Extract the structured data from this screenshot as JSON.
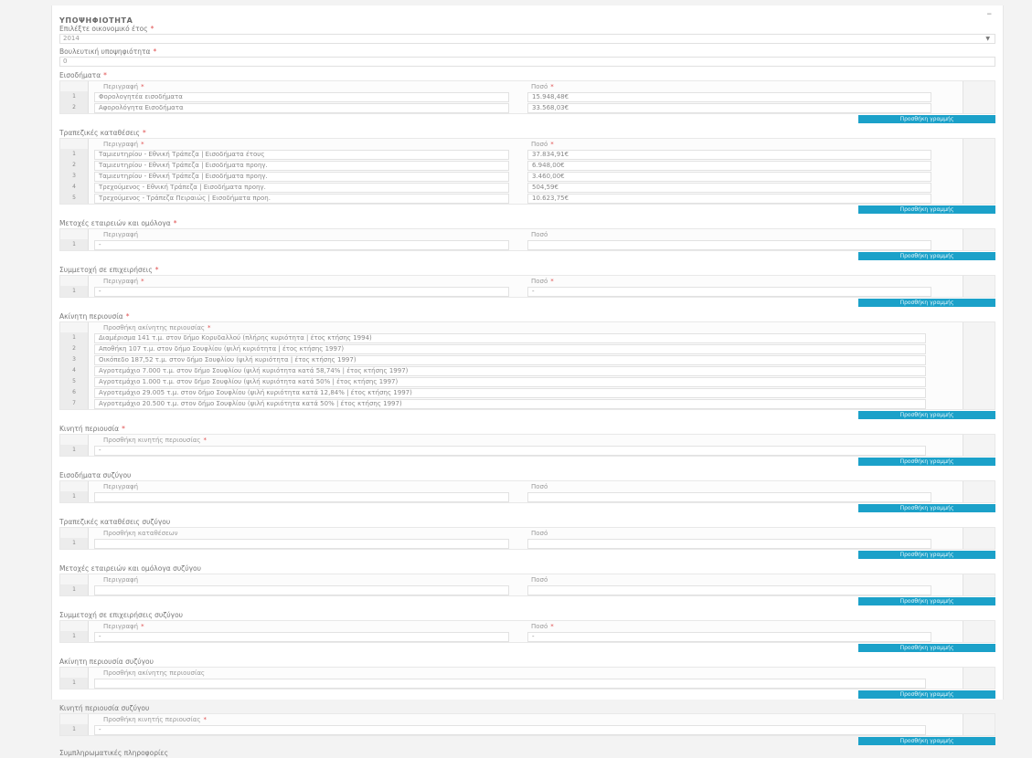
{
  "form": {
    "title": "ΥΠΟΨΗΦΙΟΤΗΤΑ",
    "year_label": "Επιλέξτε οικονομικό έτος",
    "year_value": "2014",
    "obligation_label": "Βουλευτική υποψηφιότητα",
    "obligation_value": "0",
    "add_row_label": "Προσθήκη γραμμής",
    "desc_header": "Περιγραφή",
    "amount_header": "Ποσό"
  },
  "income": {
    "label": "Εισοδήματα",
    "rows": [
      {
        "desc": "Φορολογητέα εισοδήματα",
        "amount": "15.948,48€"
      },
      {
        "desc": "Αφορολόγητα Εισοδήματα",
        "amount": "33.568,03€"
      }
    ]
  },
  "deposits": {
    "label": "Τραπεζικές καταθέσεις",
    "rows": [
      {
        "desc": "Ταμιευτηρίου - Εθνική Τράπεζα | Εισοδήματα έτους",
        "amount": "37.834,91€"
      },
      {
        "desc": "Ταμιευτηρίου - Εθνική Τράπεζα | Εισοδήματα προηγ.",
        "amount": "6.948,00€"
      },
      {
        "desc": "Ταμιευτηρίου - Εθνική Τράπεζα | Εισοδήματα προηγ.",
        "amount": "3.460,00€"
      },
      {
        "desc": "Τρεχούμενος - Εθνική Τράπεζα | Εισοδήματα προηγ.",
        "amount": "504,59€"
      },
      {
        "desc": "Τρεχούμενος - Τράπεζα Πειραιώς | Εισοδήματα προη.",
        "amount": "10.623,75€"
      }
    ]
  },
  "shares": {
    "label": "Μετοχές εταιρειών και ομόλογα",
    "rows": [
      {
        "desc": "-",
        "amount": ""
      }
    ]
  },
  "participation": {
    "label": "Συμμετοχή σε επιχειρήσεις",
    "rows": [
      {
        "desc": "-",
        "amount": "-"
      }
    ]
  },
  "real_estate": {
    "label": "Ακίνητη περιουσία",
    "header": "Προσθήκη ακίνητης περιουσίας",
    "rows": [
      "Διαμέρισμα 141 τ.μ. στον δήμο Κορυδαλλού (πλήρης κυριότητα | έτος κτήσης 1994)",
      "Αποθήκη 107 τ.μ. στον δήμο Σουφλίου (ψιλή κυριότητα | έτος κτήσης 1997)",
      "Οικόπεδο 187,52 τ.μ. στον δήμο Σουφλίου (ψιλή κυριότητα | έτος κτήσης 1997)",
      "Αγροτεμάχιο 7.000 τ.μ. στον δήμο Σουφλίου (ψιλή κυριότητα κατά 58,74% | έτος κτήσης 1997)",
      "Αγροτεμάχιο 1.000 τ.μ. στον δήμο Σουφλίου (ψιλή κυριότητα κατά 50% | έτος κτήσης 1997)",
      "Αγροτεμάχιο 29.005 τ.μ. στον δήμο Σουφλίου (ψιλή κυριότητα κατά 12,84% | έτος κτήσης 1997)",
      "Αγροτεμάχιο 20.500 τ.μ. στον δήμο Σουφλίου (ψιλή κυριότητα κατά 50% | έτος κτήσης 1997)"
    ]
  },
  "movable": {
    "label": "Κινητή περιουσία",
    "header": "Προσθήκη κινητής περιουσίας",
    "rows": [
      "-"
    ]
  },
  "spouse_income": {
    "label": "Εισοδήματα συζύγου",
    "rows": [
      {
        "desc": "",
        "amount": ""
      }
    ]
  },
  "spouse_deposits": {
    "label": "Τραπεζικές καταθέσεις συζύγου",
    "header": "Προσθήκη καταθέσεων",
    "rows": [
      {
        "desc": "",
        "amount": ""
      }
    ]
  },
  "spouse_shares": {
    "label": "Μετοχές εταιρειών και ομόλογα συζύγου",
    "rows": [
      {
        "desc": "",
        "amount": ""
      }
    ]
  },
  "spouse_participation": {
    "label": "Συμμετοχή σε επιχειρήσεις συζύγου",
    "rows": [
      {
        "desc": "-",
        "amount": "-"
      }
    ]
  },
  "spouse_real_estate": {
    "label": "Ακίνητη περιουσία συζύγου",
    "header": "Προσθήκη ακίνητης περιουσίας",
    "rows": [
      ""
    ]
  },
  "spouse_movable": {
    "label": "Κινητή περιουσία συζύγου",
    "header": "Προσθήκη κινητής περιουσίας",
    "rows": [
      "-"
    ]
  },
  "next_section_label": "Συμπληρωματικές πληροφορίες"
}
